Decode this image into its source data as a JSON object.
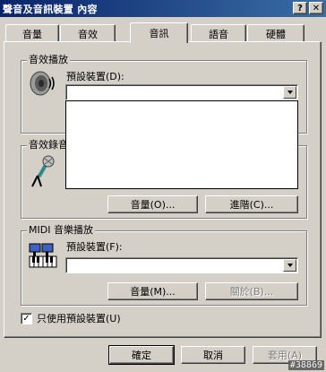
{
  "window": {
    "title": "聲音及音訊裝置 內容",
    "help_button": "?",
    "close_button": "✕"
  },
  "tabs": [
    {
      "label": "音量"
    },
    {
      "label": "音效"
    },
    {
      "label": "音訊"
    },
    {
      "label": "語音"
    },
    {
      "label": "硬體"
    }
  ],
  "playback": {
    "group_label": "音效播放",
    "device_label": "預設裝置(D):",
    "device_value": ""
  },
  "recording": {
    "group_label": "音效錄音",
    "volume_button": "音量(O)...",
    "advanced_button": "進階(C)..."
  },
  "midi": {
    "group_label": "MIDI 音樂播放",
    "device_label": "預設裝置(F):",
    "device_value": "",
    "volume_button": "音量(M)...",
    "about_button": "關於(B)..."
  },
  "options": {
    "use_default_only_label": "只使用預設裝置(U)",
    "use_default_only_checked": true
  },
  "footer": {
    "ok_button": "確定",
    "cancel_button": "取消",
    "apply_button": "套用(A)"
  },
  "watermark": "#38869",
  "colors": {
    "title_bar_start": "#0a246a",
    "title_bar_end": "#3a6ea5",
    "face": "#d4d0c8"
  }
}
